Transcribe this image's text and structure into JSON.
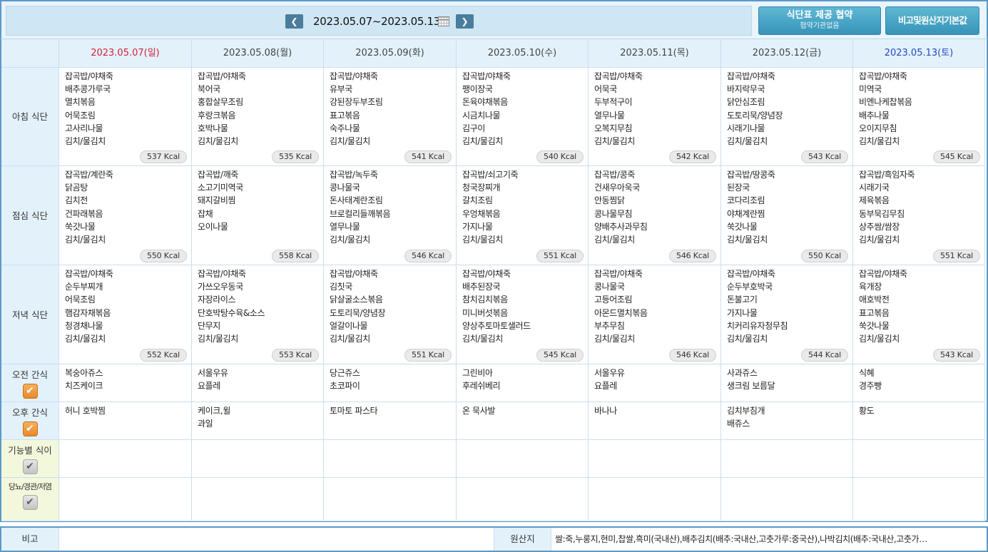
{
  "header": {
    "date_range": "2023.05.07~2023.05.13",
    "prev_icon": "chevron-left-icon",
    "next_icon": "chevron-right-icon",
    "calendar_icon": "calendar-icon",
    "agree_button": {
      "title": "식단표 제공 협약",
      "subtitle": "협약기관없음"
    },
    "origin_button": "비고및원산지기본값"
  },
  "days": [
    {
      "label": "2023.05.07(일)",
      "color": "#d3233a"
    },
    {
      "label": "2023.05.08(월)",
      "color": "#444444"
    },
    {
      "label": "2023.05.09(화)",
      "color": "#444444"
    },
    {
      "label": "2023.05.10(수)",
      "color": "#444444"
    },
    {
      "label": "2023.05.11(목)",
      "color": "#444444"
    },
    {
      "label": "2023.05.12(금)",
      "color": "#444444"
    },
    {
      "label": "2023.05.13(토)",
      "color": "#2449c2"
    }
  ],
  "meals": {
    "breakfast": {
      "label": "아침 식단",
      "cells": [
        {
          "items": [
            "잡곡밥/야채죽",
            "배추콩가루국",
            "멸치볶음",
            "어묵조림",
            "고사리나물",
            "김치/물김치"
          ],
          "kcal": "537 Kcal"
        },
        {
          "items": [
            "잡곡밥/야채죽",
            "북어국",
            "홍합살무조림",
            "후랑크볶음",
            "호박나물",
            "김치/물김치"
          ],
          "kcal": "535 Kcal"
        },
        {
          "items": [
            "잡곡밥/야채죽",
            "유부국",
            "강된장두부조림",
            "표고볶음",
            "숙주나물",
            "김치/물김치"
          ],
          "kcal": "541 Kcal"
        },
        {
          "items": [
            "잡곡밥/야채죽",
            "팽이장국",
            "돈육야채볶음",
            "시금치나물",
            "김구이",
            "김치/물김치"
          ],
          "kcal": "540 Kcal"
        },
        {
          "items": [
            "잡곡밥/야채죽",
            "어묵국",
            "두부적구이",
            "열무나물",
            "오복지무침",
            "김치/물김치"
          ],
          "kcal": "542 Kcal"
        },
        {
          "items": [
            "잡곡밥/야채죽",
            "바지락무국",
            "닭안심조림",
            "도토리묵/양념장",
            "시래기나물",
            "김치/물김치"
          ],
          "kcal": "543 Kcal"
        },
        {
          "items": [
            "잡곡밥/야채죽",
            "미역국",
            "비엔나케찹볶음",
            "배추나물",
            "오이지무침",
            "김치/물김치"
          ],
          "kcal": "545 Kcal"
        }
      ]
    },
    "lunch": {
      "label": "점심 식단",
      "cells": [
        {
          "items": [
            "잡곡밥/계란죽",
            "닭곰탕",
            "김치전",
            "건파래볶음",
            "쑥갓나물",
            "김치/물김치"
          ],
          "kcal": "550 Kcal"
        },
        {
          "items": [
            "잡곡밥/깨죽",
            "소고기미역국",
            "돼지갈비찜",
            "잡채",
            "오이나물"
          ],
          "kcal": "558 Kcal"
        },
        {
          "items": [
            "잡곡밥/녹두죽",
            "콩나물국",
            "돈사태계란조림",
            "브로컬리들깨볶음",
            "열무나물",
            "김치/물김치"
          ],
          "kcal": "546 Kcal"
        },
        {
          "items": [
            "잡곡밥/쇠고기죽",
            "청국장찌개",
            "갈치조림",
            "우엉채볶음",
            "가지나물",
            "김치/물김치"
          ],
          "kcal": "551 Kcal"
        },
        {
          "items": [
            "잡곡밥/콩죽",
            "건새우아욱국",
            "안동찜닭",
            "콩나물무침",
            "양배추사과무침",
            "김치/물김치"
          ],
          "kcal": "546 Kcal"
        },
        {
          "items": [
            "잡곡밥/땅콩죽",
            "된장국",
            "코다리조림",
            "야채계란찜",
            "쑥갓나물",
            "김치/물김치"
          ],
          "kcal": "550 Kcal"
        },
        {
          "items": [
            "잡곡밥/흑임자죽",
            "시래기국",
            "제육볶음",
            "동부묵김무침",
            "상추쌈/쌈장",
            "김치/물김치"
          ],
          "kcal": "551 Kcal"
        }
      ]
    },
    "dinner": {
      "label": "저녁 식단",
      "cells": [
        {
          "items": [
            "잡곡밥/야채죽",
            "순두부찌개",
            "어묵조림",
            "햄감자채볶음",
            "청경채나물",
            "김치/물김치"
          ],
          "kcal": "552 Kcal"
        },
        {
          "items": [
            "잡곡밥/야채죽",
            "가쓰오우동국",
            "자장라이스",
            "단호박탕수육&소스",
            "단무지",
            "김치/물김치"
          ],
          "kcal": "553 Kcal"
        },
        {
          "items": [
            "잡곡밥/야채죽",
            "김칫국",
            "닭살굴소스볶음",
            "도토리묵/양념장",
            "얼갈이나물",
            "김치/물김치"
          ],
          "kcal": "551 Kcal"
        },
        {
          "items": [
            "잡곡밥/야채죽",
            "배추된장국",
            "참치김치볶음",
            "미니버섯볶음",
            "양상추토마토샐러드",
            "김치/물김치"
          ],
          "kcal": "545 Kcal"
        },
        {
          "items": [
            "잡곡밥/야채죽",
            "콩나물국",
            "고등어조림",
            "아몬드멸치볶음",
            "부추무침",
            "김치/물김치"
          ],
          "kcal": "546 Kcal"
        },
        {
          "items": [
            "잡곡밥/야채죽",
            "순두부호박국",
            "돈불고기",
            "가지나물",
            "치커리유자청무침",
            "김치/물김치"
          ],
          "kcal": "544 Kcal"
        },
        {
          "items": [
            "잡곡밥/야채죽",
            "육개장",
            "애호박전",
            "표고볶음",
            "쑥갓나물",
            "김치/물김치"
          ],
          "kcal": "543 Kcal"
        }
      ]
    }
  },
  "snacks": {
    "am": {
      "label": "오전 간식",
      "checked": true,
      "cells": [
        [
          "복숭아쥬스",
          "치즈케이크"
        ],
        [
          "서울우유",
          "요플레"
        ],
        [
          "당근쥬스",
          "초코파이"
        ],
        [
          "그린비아",
          "후레쉬베리"
        ],
        [
          "서울우유",
          "요플레"
        ],
        [
          "사과쥬스",
          "생크림 보름달"
        ],
        [
          "식혜",
          "경주빵"
        ]
      ]
    },
    "pm": {
      "label": "오후 간식",
      "checked": true,
      "cells": [
        [
          "허니 호박찜"
        ],
        [
          "케이크,윌",
          "과일"
        ],
        [
          "토마토 파스타"
        ],
        [
          "온 묵사발"
        ],
        [
          "바나나"
        ],
        [
          "김치부침개",
          "배쥬스"
        ],
        [
          "황도"
        ]
      ]
    },
    "functional": {
      "label": "기능별 식이",
      "checked": false,
      "cells": [
        [],
        [],
        [],
        [],
        [],
        [],
        []
      ]
    },
    "diabetic": {
      "label": "당뇨/경관/저염",
      "checked": false,
      "cells": [
        [],
        [],
        [],
        [],
        [],
        [],
        []
      ]
    }
  },
  "footer": {
    "note_label": "비고",
    "note_value": "",
    "origin_label": "원산지",
    "origin_value": "쌀:죽,누룽지,현미,찹쌀,흑미(국내산),배추김치(배추:국내산,고춧가루:중국산),나박김치(배추:국내산,고춧가…"
  },
  "colors": {
    "accent": "#5b9ac9",
    "header_bg": "#e3f1fa",
    "sunday": "#d3233a",
    "saturday": "#2449c2",
    "checkbox_on": "#e8892a"
  }
}
